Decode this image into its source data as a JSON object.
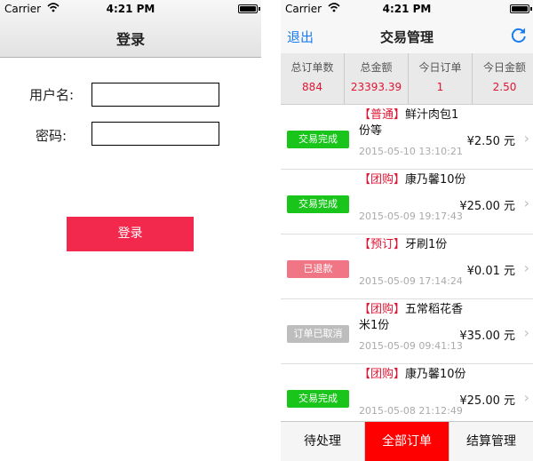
{
  "status": {
    "carrier": "Carrier",
    "time": "4:21 PM"
  },
  "login": {
    "title": "登录",
    "username_label": "用户名:",
    "username_value": "",
    "password_label": "密码:",
    "password_value": "",
    "login_button": "登录"
  },
  "orders_screen": {
    "back": "退出",
    "title": "交易管理",
    "stats": [
      {
        "label": "总订单数",
        "value": "884"
      },
      {
        "label": "总金额",
        "value": "23393.39"
      },
      {
        "label": "今日订单",
        "value": "1"
      },
      {
        "label": "今日金额",
        "value": "2.50"
      }
    ],
    "orders": [
      {
        "status": "交易完成",
        "status_color": "#19c51b",
        "tag": "【普通】",
        "name": "鲜汁肉包1份等",
        "time": "2015-05-10 13:10:21",
        "price": "¥2.50 元"
      },
      {
        "status": "交易完成",
        "status_color": "#19c51b",
        "tag": "【团购】",
        "name": "康乃馨10份",
        "time": "2015-05-09 19:17:43",
        "price": "¥25.00 元"
      },
      {
        "status": "已退款",
        "status_color": "#f07585",
        "tag": "【预订】",
        "name": "牙刷1份",
        "time": "2015-05-09 17:14:24",
        "price": "¥0.01 元"
      },
      {
        "status": "订单已取消",
        "status_color": "#bdbdbd",
        "tag": "【团购】",
        "name": "五常稻花香米1份",
        "time": "2015-05-09 09:41:13",
        "price": "¥35.00 元"
      },
      {
        "status": "交易完成",
        "status_color": "#19c51b",
        "tag": "【团购】",
        "name": "康乃馨10份",
        "time": "2015-05-08 21:12:49",
        "price": "¥25.00 元"
      }
    ],
    "tabs": [
      {
        "label": "待处理",
        "active": false
      },
      {
        "label": "全部订单",
        "active": true
      },
      {
        "label": "结算管理",
        "active": false
      }
    ]
  }
}
